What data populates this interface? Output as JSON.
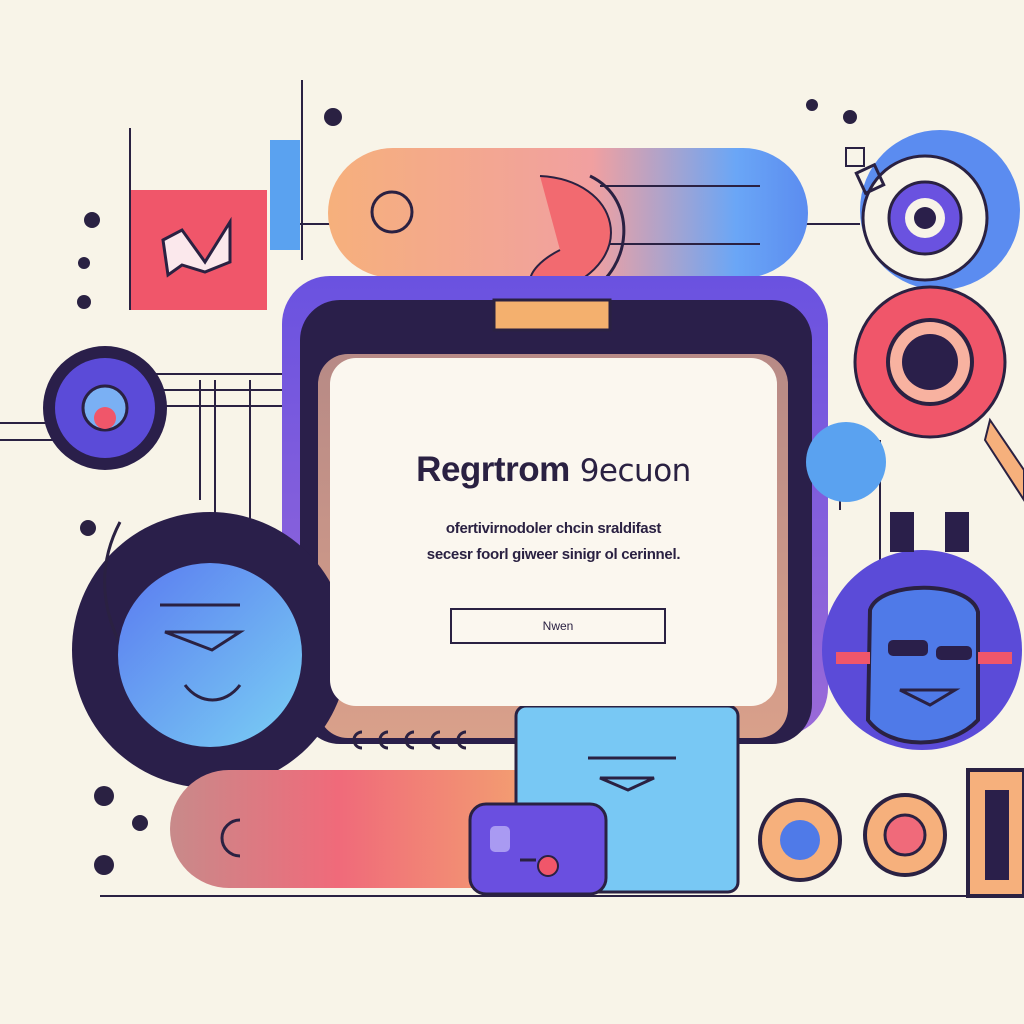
{
  "dialog": {
    "title_main": "Regrtrom",
    "title_second": "9ecuon",
    "description_line1": "ofertivirnodoler chcin sraldifast",
    "description_line2": "secesr foorl giweer sinigr ol cerinnel.",
    "button_label": "Nwen"
  },
  "colors": {
    "background": "#f8f4e8",
    "ink": "#2a2142",
    "purple": "#5b4bd8",
    "blue": "#5aa2f0",
    "coral": "#f0566a",
    "peach": "#f6b07c",
    "cyan": "#78c8f4"
  },
  "icons": [
    "play-badge-icon",
    "target-icon",
    "smiley-face-icon",
    "robot-head-icon",
    "camera-icon",
    "eye-orb-icon",
    "document-icon"
  ]
}
